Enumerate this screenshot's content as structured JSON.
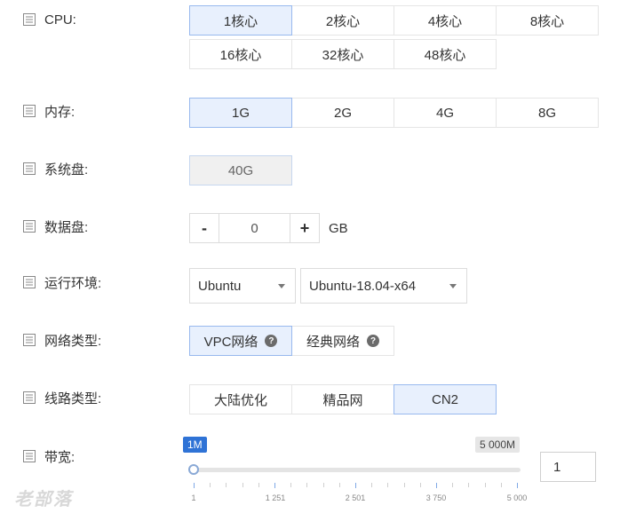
{
  "rows": {
    "cpu": {
      "label": "CPU:",
      "options": [
        "1核心",
        "2核心",
        "4核心",
        "8核心",
        "16核心",
        "32核心",
        "48核心"
      ],
      "selected": "1核心"
    },
    "memory": {
      "label": "内存:",
      "options": [
        "1G",
        "2G",
        "4G",
        "8G"
      ],
      "selected": "1G"
    },
    "system_disk": {
      "label": "系统盘:",
      "value": "40G"
    },
    "data_disk": {
      "label": "数据盘:",
      "decrement": "-",
      "increment": "+",
      "value": "0",
      "unit": "GB"
    },
    "runtime": {
      "label": "运行环境:",
      "os": "Ubuntu",
      "version": "Ubuntu-18.04-x64"
    },
    "network_type": {
      "label": "网络类型:",
      "options": [
        "VPC网络",
        "经典网络"
      ],
      "selected": "VPC网络",
      "help": "?"
    },
    "line_type": {
      "label": "线路类型:",
      "options": [
        "大陆优化",
        "精品网",
        "CN2"
      ],
      "selected": "CN2"
    },
    "bandwidth": {
      "label": "带宽:",
      "min_label": "1M",
      "max_label": "5 000M",
      "current_value": "1",
      "slider_value": 1,
      "ticks": [
        "1",
        "1 251",
        "2 501",
        "3 750",
        "5 000"
      ]
    }
  },
  "watermark": "老部落",
  "colors": {
    "selected_bg": "#e8f0fd",
    "selected_border": "#98b9ee",
    "accent": "#2f73d6"
  },
  "icons": {
    "row_label": "list-icon",
    "help": "question-circle-icon"
  }
}
